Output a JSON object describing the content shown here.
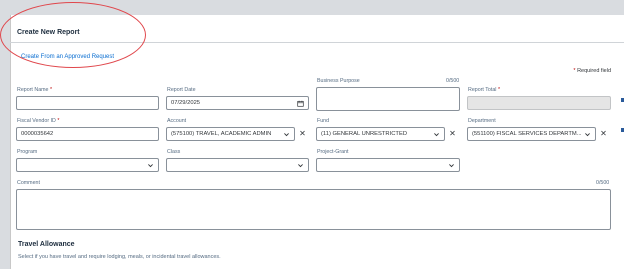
{
  "header": {
    "title": "Create New Report",
    "approved_link": "Create From an Approved Request"
  },
  "required_note": {
    "star": "*",
    "text": "Required field"
  },
  "fields": {
    "report_name": {
      "label": "Report Name",
      "required": "*",
      "value": ""
    },
    "report_date": {
      "label": "Report Date",
      "value": "07/29/2025"
    },
    "business_purpose": {
      "label": "Business Purpose",
      "count": "0/500",
      "value": ""
    },
    "report_total": {
      "label": "Report Total",
      "required": "*",
      "value": ""
    },
    "fiscal_vendor_id": {
      "label": "Fiscal Vendor ID",
      "required": "*",
      "value": "0000035642"
    },
    "account": {
      "label": "Account",
      "value": "(575100) TRAVEL, ACADEMIC ADMIN"
    },
    "fund": {
      "label": "Fund",
      "value": "(11) GENERAL UNRESTRICTED"
    },
    "department": {
      "label": "Department",
      "value": "(551100) FISCAL SERVICES DEPARTM..."
    },
    "program": {
      "label": "Program",
      "value": ""
    },
    "class": {
      "label": "Class",
      "value": ""
    },
    "project_grant": {
      "label": "Project-Grant",
      "value": ""
    },
    "comment": {
      "label": "Comment",
      "count": "0/500",
      "value": ""
    }
  },
  "travel_allowance": {
    "title": "Travel Allowance",
    "description": "Select if you have travel and require lodging, meals, or incidental travel allowances."
  },
  "icons": {
    "clear": "✕",
    "chevron": "chevron-down-icon",
    "calendar": "calendar-icon"
  },
  "colors": {
    "annotation": "#e0474c",
    "link": "#0a6ed1",
    "required": "#bb0000"
  }
}
